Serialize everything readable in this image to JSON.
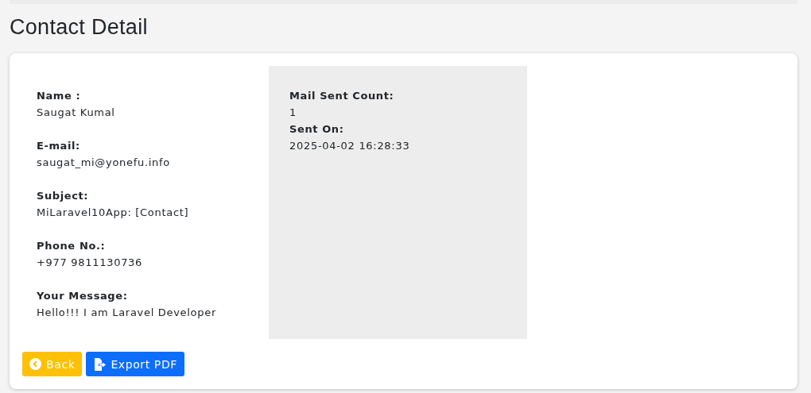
{
  "title": "Contact Detail",
  "fields": [
    {
      "label": "Name :",
      "value": "Saugat Kumal"
    },
    {
      "label": "E-mail:",
      "value": "saugat_mi@yonefu.info"
    },
    {
      "label": "Subject:",
      "value": "MiLaravel10App: [Contact]"
    },
    {
      "label": "Phone No.:",
      "value": "+977 9811130736"
    },
    {
      "label": "Your Message:",
      "value": "Hello!!! I am Laravel Developer"
    }
  ],
  "mail_info": [
    {
      "label": "Mail Sent Count:",
      "value": "1"
    },
    {
      "label": "Sent On:",
      "value": "2025-04-02 16:28:33"
    }
  ],
  "buttons": [
    {
      "kind": "back",
      "label": "Back"
    },
    {
      "kind": "export",
      "label": "Export PDF"
    }
  ]
}
